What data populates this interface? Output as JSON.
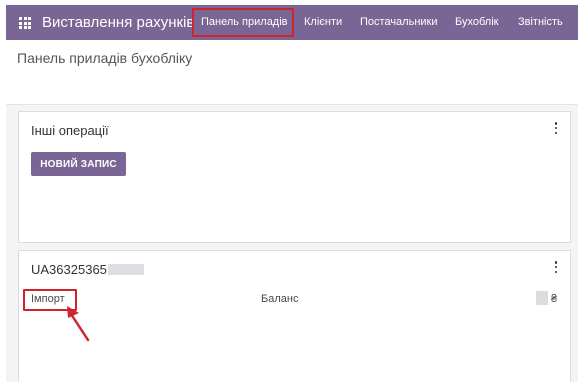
{
  "navbar": {
    "apps_icon": "apps-grid-icon",
    "app_title": "Виставлення рахунків",
    "menu": [
      {
        "label": "Панель приладів",
        "active": true
      },
      {
        "label": "Клієнти"
      },
      {
        "label": "Постачальники"
      },
      {
        "label": "Бухоблік"
      },
      {
        "label": "Звітність"
      }
    ]
  },
  "page": {
    "title": "Панель приладів бухобліку"
  },
  "cards": [
    {
      "title": "Інші операції",
      "menu_icon": "kebab-icon",
      "button_label": "НОВИЙ ЗАПИС"
    },
    {
      "title": "UA36325365",
      "menu_icon": "kebab-icon",
      "import_label": "Імпорт",
      "balance_label": "Баланс",
      "currency": "₴"
    }
  ],
  "annotations": {
    "highlight_color": "#d0242c",
    "arrow_icon": "red-arrow-icon"
  },
  "colors": {
    "brand": "#7a6694",
    "card_border": "#dcdce0",
    "background": "#f4f4f6"
  }
}
